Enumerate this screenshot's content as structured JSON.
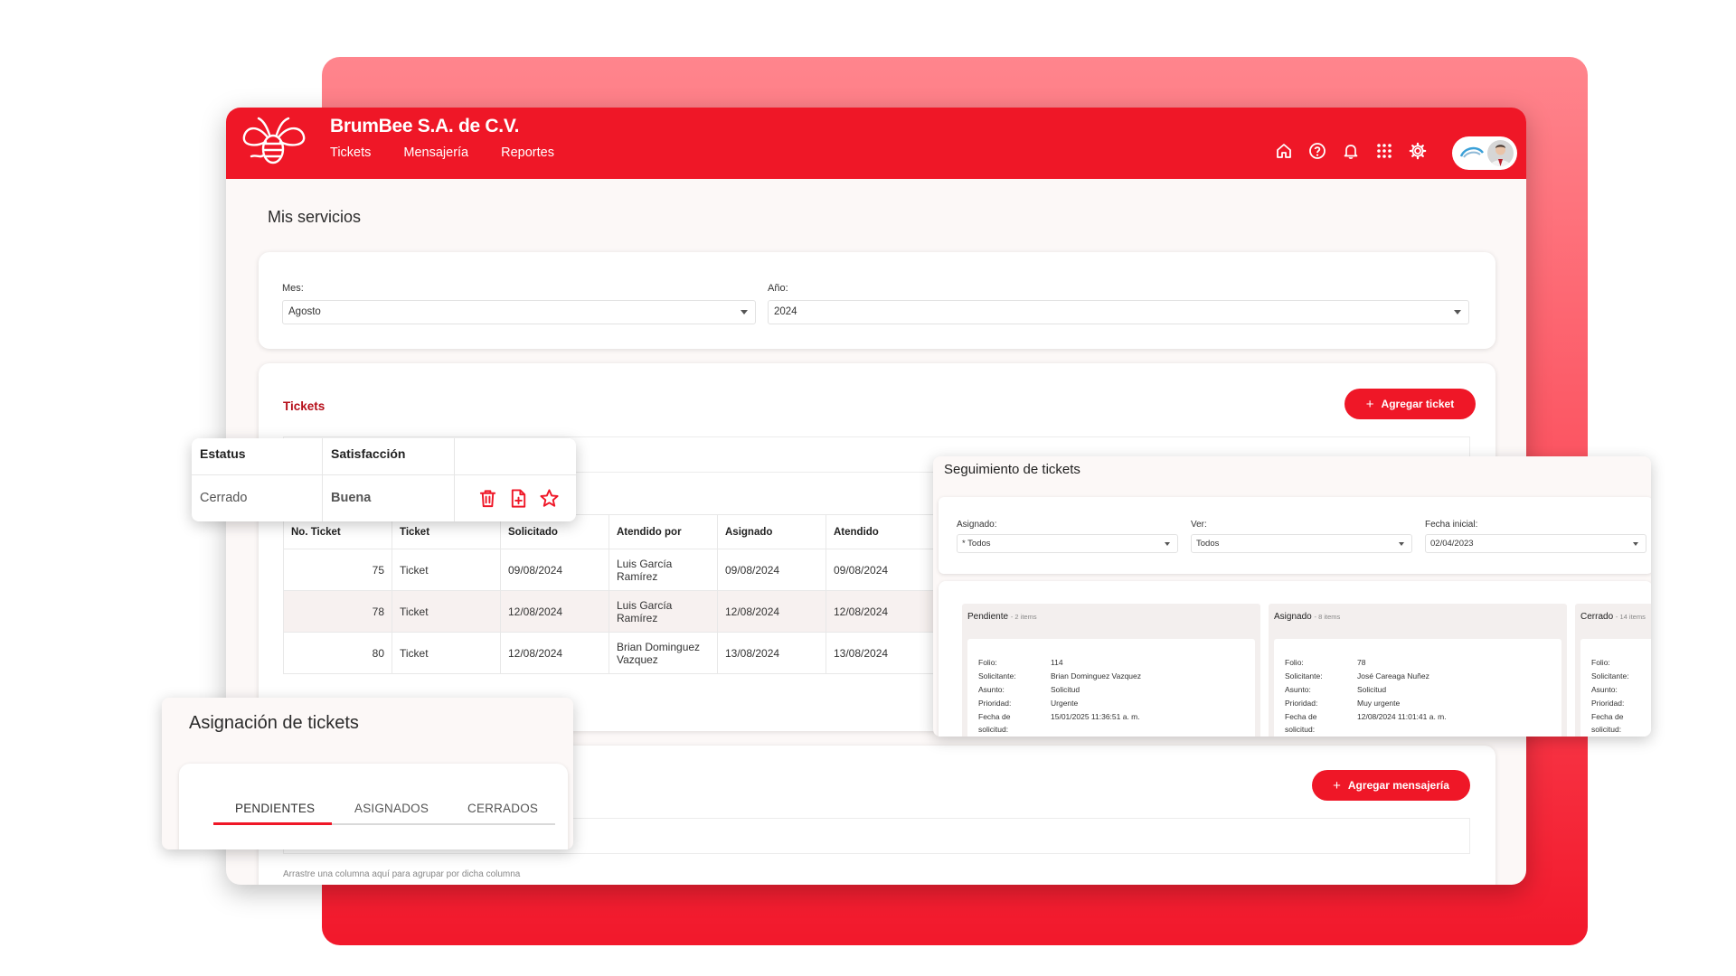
{
  "app": {
    "company": "BrumBee S.A. de C.V.",
    "nav": [
      "Tickets",
      "Mensajería",
      "Reportes"
    ],
    "colors": {
      "primary": "#ef1727",
      "accent_dark": "#b50d18",
      "backdrop": "#fb4a58"
    },
    "icons": [
      "home-icon",
      "help-icon",
      "bell-icon",
      "apps-grid-icon",
      "gear-icon"
    ]
  },
  "page": {
    "title": "Mis servicios"
  },
  "filters": {
    "month_label": "Mes:",
    "month_value": "Agosto",
    "year_label": "Año:",
    "year_value": "2024"
  },
  "tickets": {
    "title": "Tickets",
    "add_button": "Agregar ticket",
    "columns": [
      "No. Ticket",
      "Ticket",
      "Solicitado",
      "Atendido por",
      "Asignado",
      "Atendido"
    ],
    "rows": [
      {
        "no": "75",
        "ticket": "Ticket",
        "solicitado": "09/08/2024",
        "atendido_por": "Luis García Ramírez",
        "asignado": "09/08/2024",
        "atendido": "09/08/2024"
      },
      {
        "no": "78",
        "ticket": "Ticket",
        "solicitado": "12/08/2024",
        "atendido_por": "Luis García Ramírez",
        "asignado": "12/08/2024",
        "atendido": "12/08/2024"
      },
      {
        "no": "80",
        "ticket": "Ticket",
        "solicitado": "12/08/2024",
        "atendido_por": "Brian Dominguez Vazquez",
        "asignado": "13/08/2024",
        "atendido": "13/08/2024"
      }
    ]
  },
  "mensajeria": {
    "add_button": "Agregar mensajería",
    "drag_hint": "Arrastre una columna aquí para agrupar por dicha columna"
  },
  "status_popup": {
    "col_status": "Estatus",
    "col_satisfaction": "Satisfacción",
    "status_value": "Cerrado",
    "satisfaction_value": "Buena",
    "action_icons": [
      "trash-icon",
      "file-add-icon",
      "star-icon"
    ]
  },
  "asignacion": {
    "title": "Asignación de tickets",
    "tabs": [
      "PENDIENTES",
      "ASIGNADOS",
      "CERRADOS"
    ],
    "active_tab": "PENDIENTES"
  },
  "seguimiento": {
    "title": "Seguimiento de tickets",
    "filters": [
      {
        "label": "Asignado:",
        "value": "* Todos"
      },
      {
        "label": "Ver:",
        "value": "Todos"
      },
      {
        "label": "Fecha inicial:",
        "value": "02/04/2023"
      }
    ],
    "columns": [
      {
        "name": "Pendiente",
        "count": "- 2 items",
        "card": {
          "folio": "114",
          "solicitante": "Brian Dominguez Vazquez",
          "asunto": "Solicitud",
          "prioridad": "Urgente",
          "fecha": "15/01/2025 11:36:51 a. m."
        }
      },
      {
        "name": "Asignado",
        "count": "- 8 items",
        "card": {
          "folio": "78",
          "solicitante": "José Careaga Nuñez",
          "asunto": "Solicitud",
          "prioridad": "Muy urgente",
          "fecha": "12/08/2024 11:01:41 a. m."
        }
      },
      {
        "name": "Cerrado",
        "count": "- 14 items",
        "card": {}
      }
    ],
    "field_labels": {
      "folio": "Folio:",
      "solicitante": "Solicitante:",
      "asunto": "Asunto:",
      "prioridad": "Prioridad:",
      "fecha_1": "Fecha de",
      "fecha_2": "solicitud:"
    }
  }
}
